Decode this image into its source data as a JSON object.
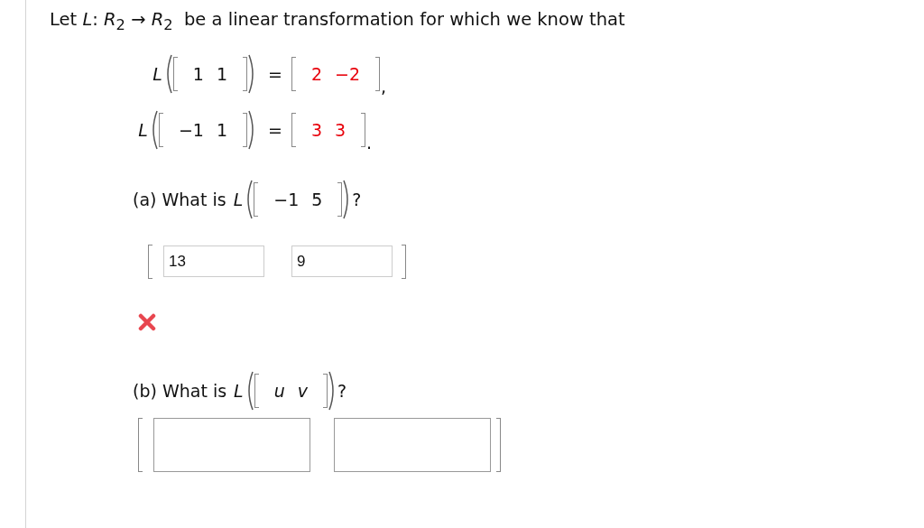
{
  "intro": "Let *L*: *R*$_{2}$ → *R*$_{2}$  be a linear transformation for which we know that",
  "equations": [
    {
      "fn": "L",
      "input": [
        "1",
        "1"
      ],
      "equals": "=",
      "output": [
        "2",
        "−2"
      ],
      "punct": ","
    },
    {
      "fn": "L",
      "input": [
        "−1",
        "1"
      ],
      "equals": "=",
      "output": [
        "3",
        "3"
      ],
      "punct": "."
    }
  ],
  "parts": [
    {
      "kind": "numeric",
      "label": "(a) What is",
      "fn": "L",
      "input": [
        "−1",
        "5"
      ],
      "end": "?",
      "answers": [
        {
          "kind": "compact",
          "value": "13"
        },
        {
          "kind": "compact",
          "value": "9"
        }
      ],
      "incorrect": true
    },
    {
      "kind": "symbolic",
      "label": "(b) What is",
      "fn": "L",
      "input": [
        "u",
        "v"
      ],
      "end": "?",
      "answers": [
        {
          "kind": "wide"
        },
        {
          "kind": "wide"
        }
      ],
      "incorrect": false
    }
  ]
}
